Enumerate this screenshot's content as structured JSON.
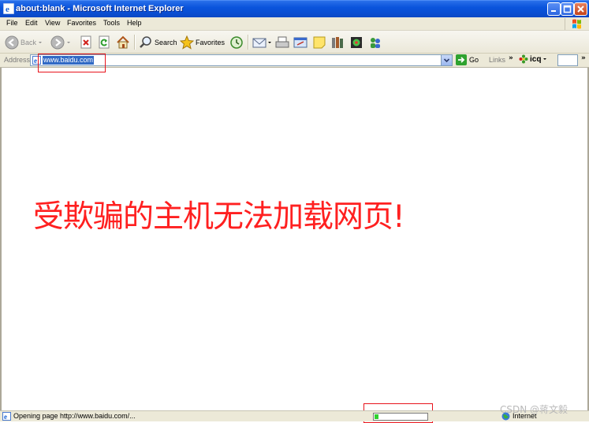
{
  "window": {
    "title": "about:blank - Microsoft Internet Explorer"
  },
  "menu": [
    "File",
    "Edit",
    "View",
    "Favorites",
    "Tools",
    "Help"
  ],
  "toolbar": {
    "back_label": "Back",
    "search_label": "Search",
    "favorites_label": "Favorites"
  },
  "address": {
    "label": "Address",
    "value": "www.baidu.com",
    "go_label": "Go"
  },
  "links": {
    "label": "Links",
    "icq_label": "icq"
  },
  "content": {
    "message": "受欺骗的主机无法加载网页!"
  },
  "status": {
    "text": "Opening page http://www.baidu.com/...",
    "progress_fraction": 0.08,
    "zone": "Internet"
  },
  "watermark": "CSDN @蒋文毅",
  "colors": {
    "titlebar": "#0a54dc",
    "message": "#ff2020",
    "annotation": "#e8141c"
  }
}
